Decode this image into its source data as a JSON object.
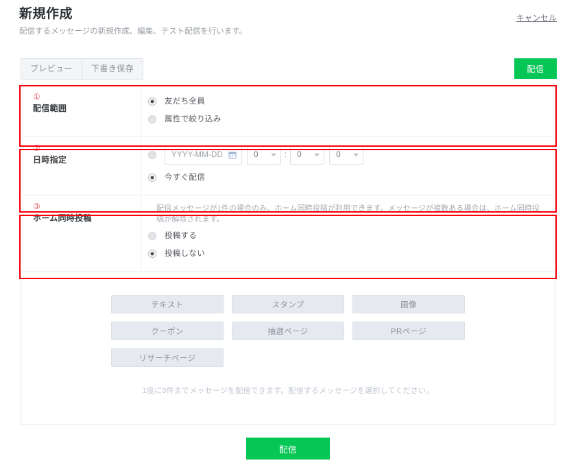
{
  "header": {
    "title": "新規作成",
    "subtitle": "配信するメッセージの新規作成、編集、テスト配信を行います。",
    "cancel_label": "キャンセル"
  },
  "toolbar": {
    "preview_label": "プレビュー",
    "save_draft_label": "下書き保存",
    "deliver_label": "配信"
  },
  "sections": [
    {
      "marker": "①",
      "title": "配信範囲",
      "options": [
        {
          "label": "友だち全員",
          "checked": true
        },
        {
          "label": "属性で絞り込み",
          "checked": false
        }
      ]
    },
    {
      "marker": "②",
      "title": "日時指定",
      "date_placeholder": "YYYY-MM-DD",
      "calendar_icon": "calendar-icon",
      "time_separator": ":",
      "time_selects": [
        {
          "value": "0"
        },
        {
          "value": "0"
        },
        {
          "value": "0"
        }
      ],
      "schedule_radio_checked": false,
      "now_option": {
        "label": "今すぐ配信",
        "checked": true
      }
    },
    {
      "marker": "③",
      "title": "ホーム同時投稿",
      "help": "配信メッセージが1件の場合のみ、ホーム同時投稿が利用できます。メッセージが複数ある場合は、ホーム同時投稿が解除されます。",
      "options": [
        {
          "label": "投稿する",
          "checked": false
        },
        {
          "label": "投稿しない",
          "checked": true
        }
      ]
    }
  ],
  "message_types": [
    {
      "label": "テキスト"
    },
    {
      "label": "スタンプ"
    },
    {
      "label": "画像"
    },
    {
      "label": "クーポン"
    },
    {
      "label": "抽選ページ"
    },
    {
      "label": "PRページ"
    },
    {
      "label": "リサーチページ"
    }
  ],
  "types_hint": "1度に3件までメッセージを配信できます。配信するメッセージを選択してください。",
  "submit": {
    "label": "配信"
  },
  "colors": {
    "accent_green": "#06c755",
    "annotation_red": "#fb0007",
    "marker_red": "#e8535c",
    "panel_border": "#e6e8eb",
    "type_button_bg": "#e6eaf0"
  }
}
